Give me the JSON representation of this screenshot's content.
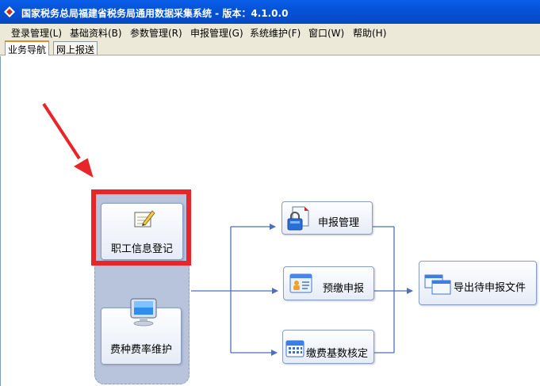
{
  "window": {
    "title": "国家税务总局福建省税务局通用数据采集系统 - 版本：4.1.0.0",
    "accent_color": "#0553d8"
  },
  "menu": [
    "登录管理(L)",
    "基础资料(B)",
    "参数管理(R)",
    "申报管理(G)",
    "系统维护(F)",
    "窗口(W)",
    "帮助(H)"
  ],
  "tabs": [
    {
      "label": "业务导航",
      "active": true
    },
    {
      "label": "网上报送",
      "active": false
    }
  ],
  "nodes": {
    "staff_info": {
      "label": "职工信息登记",
      "icon": "edit-icon"
    },
    "fee_rate": {
      "label": "费种费率维护",
      "icon": "monitor-icon"
    },
    "declare_mgmt": {
      "label": "申报管理",
      "icon": "document-lock-icon"
    },
    "prepay": {
      "label": "预缴申报",
      "icon": "contact-card-icon"
    },
    "base_verify": {
      "label": "缴费基数核定",
      "icon": "calendar-icon"
    },
    "export_file": {
      "label": "导出待申报文件",
      "icon": "windows-icon"
    }
  },
  "annotation": {
    "arrow_color": "#e8262a",
    "box_color": "#e8262a"
  }
}
